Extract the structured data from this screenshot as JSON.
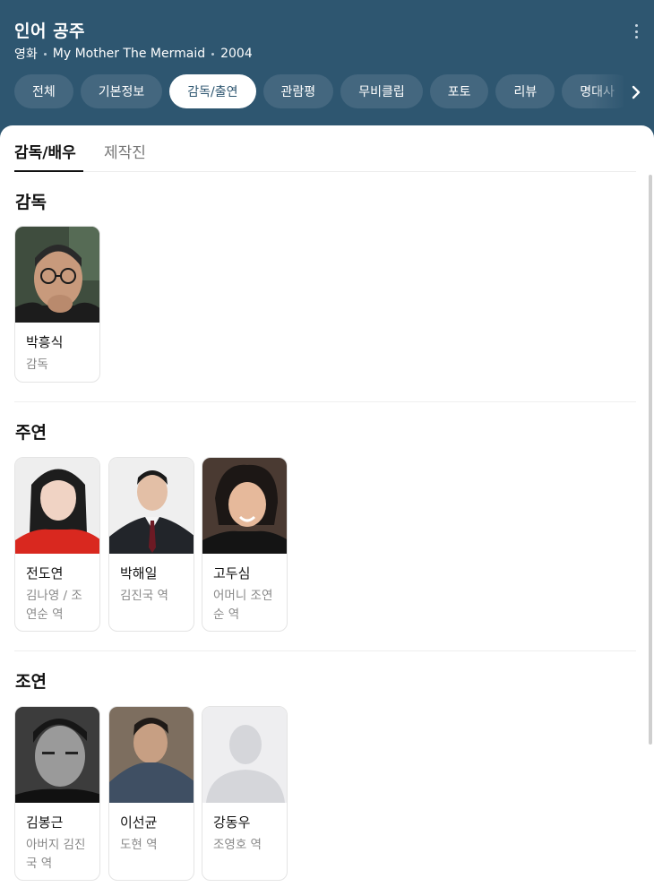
{
  "header": {
    "title": "인어 공주",
    "genre": "영화",
    "original_title": "My Mother The Mermaid",
    "year": "2004"
  },
  "chips": [
    "전체",
    "기본정보",
    "감독/출연",
    "관람평",
    "무비클립",
    "포토",
    "리뷰",
    "명대사"
  ],
  "active_chip": "감독/출연",
  "subtabs": [
    "감독/배우",
    "제작진"
  ],
  "sections": {
    "director": {
      "title": "감독",
      "people": [
        {
          "name": "박흥식",
          "role": "감독"
        }
      ]
    },
    "lead": {
      "title": "주연",
      "people": [
        {
          "name": "전도연",
          "role": "김나영 / 조연순 역"
        },
        {
          "name": "박해일",
          "role": "김진국 역"
        },
        {
          "name": "고두심",
          "role": "어머니 조연순 역"
        }
      ]
    },
    "supporting": {
      "title": "조연",
      "people": [
        {
          "name": "김봉근",
          "role": "아버지 김진국 역"
        },
        {
          "name": "이선균",
          "role": "도현 역"
        },
        {
          "name": "강동우",
          "role": "조영호 역"
        }
      ]
    }
  },
  "icons": {
    "more": "more-vertical-icon",
    "scroll_right": "chevron-right-icon",
    "placeholder": "person-placeholder-icon"
  },
  "colors": {
    "header_bg": "#2e5670",
    "chip_bg": "#44677f",
    "active_chip_text": "#2e5670"
  }
}
